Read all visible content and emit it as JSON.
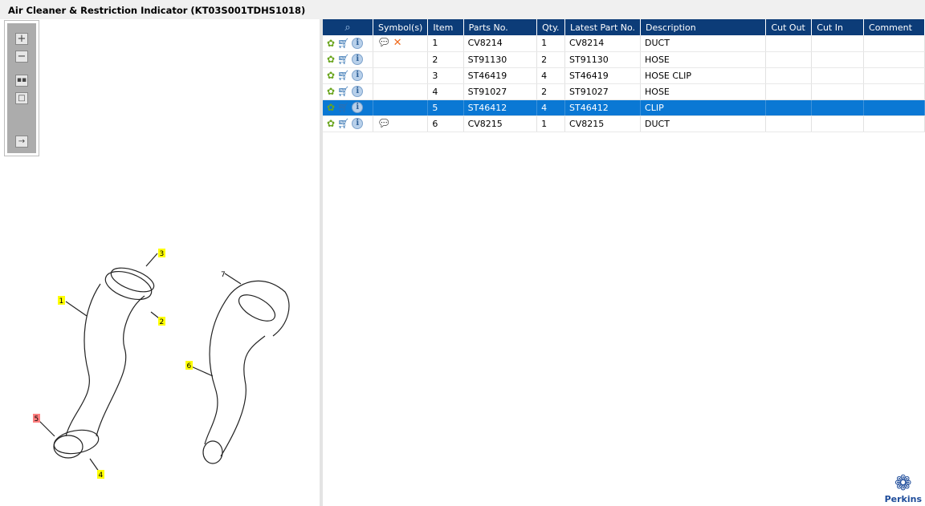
{
  "window": {
    "title": "Air Cleaner & Restriction Indicator (KT03S001TDHS1018)"
  },
  "toolbar": {
    "buttons": [
      "zoom-in",
      "zoom-out",
      "fit-all",
      "fit-window",
      "toggle-list"
    ]
  },
  "drawing": {
    "callouts": [
      "1",
      "2",
      "3",
      "4",
      "5",
      "6",
      "7"
    ],
    "highlighted": "5",
    "colors": {
      "callout": "#ffff00",
      "highlight": "#ff7f7f"
    }
  },
  "table": {
    "columns": [
      "Symbol(s)",
      "Item",
      "Parts No.",
      "Qty.",
      "Latest Part No.",
      "Description",
      "Cut Out",
      "Cut In",
      "Comment"
    ],
    "rows": [
      {
        "symbols": [
          "note",
          "cross"
        ],
        "item": "1",
        "part": "CV8214",
        "qty": "1",
        "latest": "CV8214",
        "desc": "DUCT",
        "cut_out": "",
        "cut_in": "",
        "comment": ""
      },
      {
        "symbols": [],
        "item": "2",
        "part": "ST91130",
        "qty": "2",
        "latest": "ST91130",
        "desc": "HOSE",
        "cut_out": "",
        "cut_in": "",
        "comment": ""
      },
      {
        "symbols": [],
        "item": "3",
        "part": "ST46419",
        "qty": "4",
        "latest": "ST46419",
        "desc": "HOSE CLIP",
        "cut_out": "",
        "cut_in": "",
        "comment": ""
      },
      {
        "symbols": [],
        "item": "4",
        "part": "ST91027",
        "qty": "2",
        "latest": "ST91027",
        "desc": "HOSE",
        "cut_out": "",
        "cut_in": "",
        "comment": ""
      },
      {
        "symbols": [],
        "item": "5",
        "part": "ST46412",
        "qty": "4",
        "latest": "ST46412",
        "desc": "CLIP",
        "cut_out": "",
        "cut_in": "",
        "comment": ""
      },
      {
        "symbols": [
          "note"
        ],
        "item": "6",
        "part": "CV8215",
        "qty": "1",
        "latest": "CV8215",
        "desc": "DUCT",
        "cut_out": "",
        "cut_in": "",
        "comment": ""
      }
    ],
    "selected_row": 4,
    "accent": "#0c3c78",
    "selection": "#0a78d4"
  },
  "brand": {
    "name": "Perkins"
  }
}
